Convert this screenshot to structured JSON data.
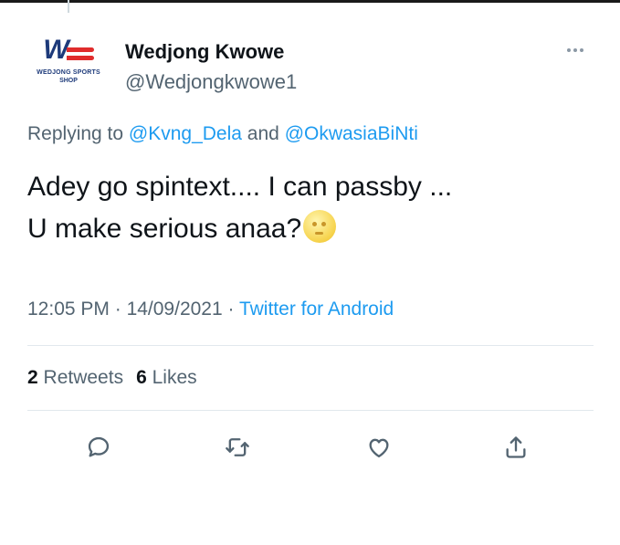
{
  "author": {
    "display_name": "Wedjong Kwowe",
    "handle": "@Wedjongkwowe1",
    "avatar": {
      "logo_text": "W",
      "subtitle_line1": "WEDJONG SPORTS",
      "subtitle_line2": "SHOP",
      "colors": {
        "blue": "#1d3a7a",
        "red": "#e02c2c"
      }
    }
  },
  "more_menu_icon": "more-horizontal-icon",
  "replying": {
    "prefix": "Replying to ",
    "mention_1": "@Kvng_Dela",
    "conjunction": " and ",
    "mention_2": "@OkwasiaBiNti"
  },
  "tweet": {
    "line_1": "Adey go spintext.... I can passby ...",
    "line_2": "U make serious anaa?",
    "emoji": "neutral-face-emoji"
  },
  "meta": {
    "time": "12:05 PM",
    "separator": " · ",
    "date": "14/09/2021",
    "source": "Twitter for Android"
  },
  "stats": {
    "retweets_count": "2",
    "retweets_label": "Retweets",
    "likes_count": "6",
    "likes_label": "Likes"
  },
  "actions": {
    "reply_icon": "reply-icon",
    "retweet_icon": "retweet-icon",
    "like_icon": "like-icon",
    "share_icon": "share-icon"
  },
  "colors": {
    "link_blue": "#1d9bf0",
    "secondary_text": "#536471",
    "primary_text": "#0f1419",
    "divider": "#e1e8ed"
  }
}
